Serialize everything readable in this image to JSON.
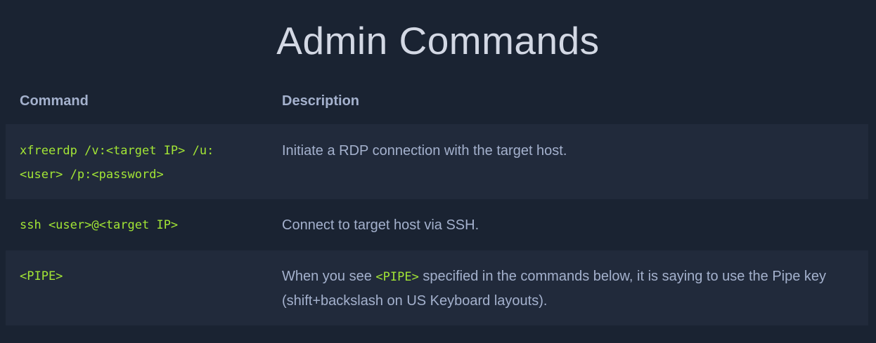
{
  "title": "Admin Commands",
  "table": {
    "headers": {
      "command": "Command",
      "description": "Description"
    },
    "rows": [
      {
        "command_line1": "xfreerdp /v:<target IP> /u:",
        "command_line2": "<user> /p:<password>",
        "description": "Initiate a RDP connection with the target host."
      },
      {
        "command_line1": "ssh <user>@<target IP>",
        "description": "Connect to target host via SSH."
      },
      {
        "command_line1": "<PIPE>",
        "description_before": "When you see ",
        "description_code": "<PIPE>",
        "description_after": " specified in the commands below, it is saying to use the Pipe key (shift+backslash on US Keyboard layouts)."
      }
    ]
  },
  "colors": {
    "background": "#1a2332",
    "row_alt": "#212a3b",
    "code": "#a3e635",
    "text": "#a4b1cd",
    "title": "#d3d8e4"
  }
}
